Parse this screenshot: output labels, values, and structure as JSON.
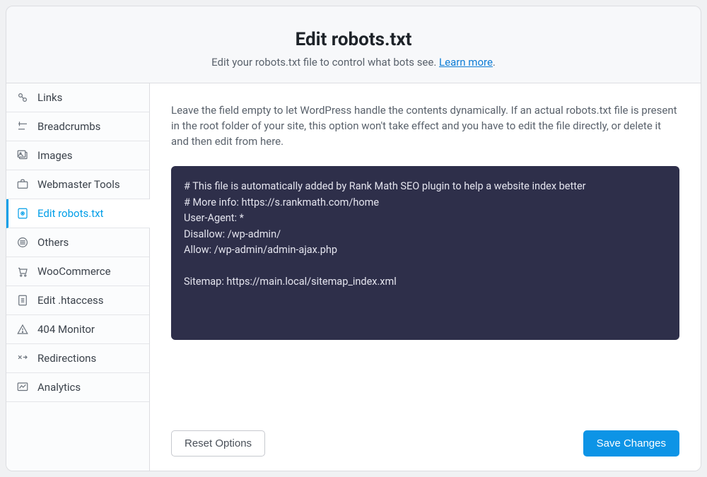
{
  "header": {
    "title": "Edit robots.txt",
    "subtitle_pre": "Edit your robots.txt file to control what bots see. ",
    "learn_more": "Learn more",
    "subtitle_post": "."
  },
  "sidebar": {
    "items": [
      {
        "label": "Links",
        "icon": "links-icon"
      },
      {
        "label": "Breadcrumbs",
        "icon": "breadcrumbs-icon"
      },
      {
        "label": "Images",
        "icon": "images-icon"
      },
      {
        "label": "Webmaster Tools",
        "icon": "webmaster-icon"
      },
      {
        "label": "Edit robots.txt",
        "icon": "robots-icon",
        "active": true
      },
      {
        "label": "Others",
        "icon": "others-icon"
      },
      {
        "label": "WooCommerce",
        "icon": "woocommerce-icon"
      },
      {
        "label": "Edit .htaccess",
        "icon": "htaccess-icon"
      },
      {
        "label": "404 Monitor",
        "icon": "monitor-icon"
      },
      {
        "label": "Redirections",
        "icon": "redirections-icon"
      },
      {
        "label": "Analytics",
        "icon": "analytics-icon"
      }
    ]
  },
  "main": {
    "description": "Leave the field empty to let WordPress handle the contents dynamically. If an actual robots.txt file is present in the root folder of your site, this option won't take effect and you have to edit the file directly, or delete it and then edit from here.",
    "editor_value": "# This file is automatically added by Rank Math SEO plugin to help a website index better\n# More info: https://s.rankmath.com/home\nUser-Agent: *\nDisallow: /wp-admin/\nAllow: /wp-admin/admin-ajax.php\n\nSitemap: https://main.local/sitemap_index.xml"
  },
  "footer": {
    "reset_label": "Reset Options",
    "save_label": "Save Changes"
  },
  "colors": {
    "accent": "#009ee8",
    "editor_bg": "#2e2f4a",
    "primary_btn": "#0d94e6"
  }
}
